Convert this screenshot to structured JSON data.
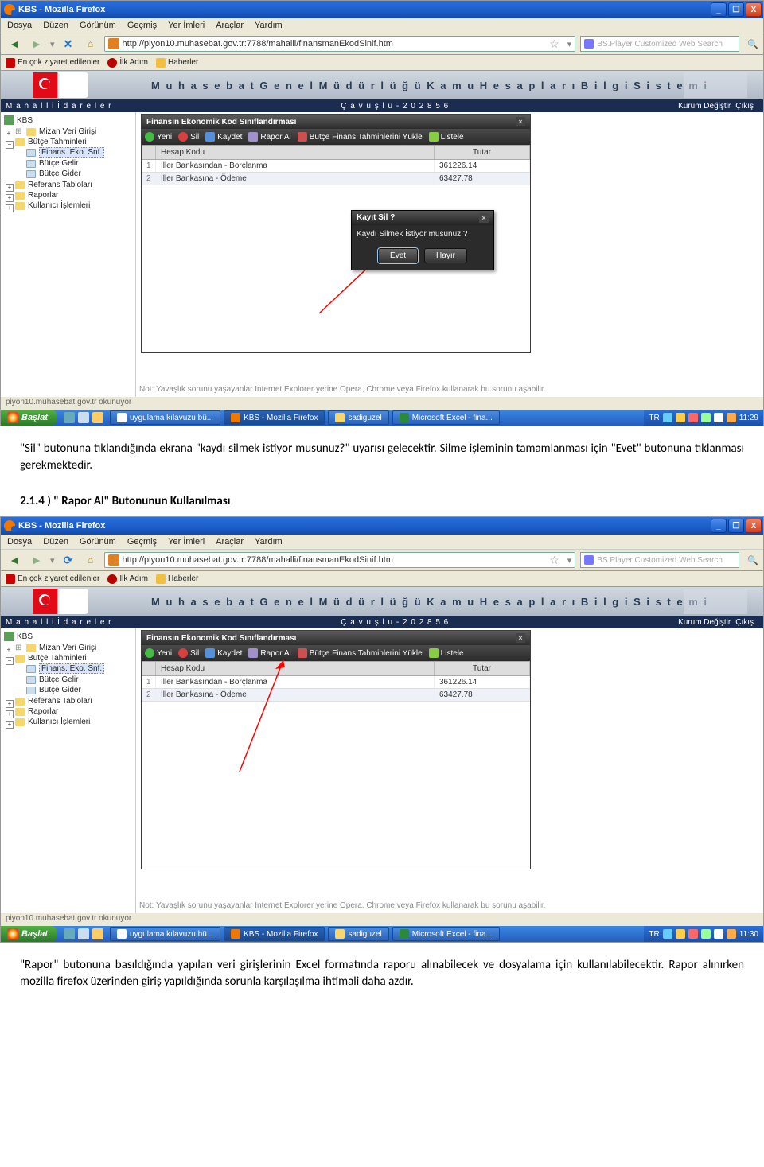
{
  "doc": {
    "para1": "\"Sil\" butonuna tıklandığında ekrana \"kaydı silmek istiyor musunuz?\" uyarısı gelecektir. Silme işleminin tamamlanması için \"Evet\" butonuna tıklanması gerekmektedir.",
    "heading": "2.1.4 ) \" Rapor Al\" Butonunun Kullanılması",
    "para2": "\"Rapor\" butonuna basıldığında yapılan veri girişlerinin Excel formatında raporu alınabilecek ve dosyalama için kullanılabilecektir. Rapor alınırken mozilla firefox üzerinden giriş yapıldığında sorunla karşılaşılma ihtimali daha azdır."
  },
  "firefox": {
    "title": "KBS - Mozilla Firefox",
    "menu": [
      "Dosya",
      "Düzen",
      "Görünüm",
      "Geçmiş",
      "Yer İmleri",
      "Araçlar",
      "Yardım"
    ],
    "url": "http://piyon10.muhasebat.gov.tr:7788/mahalli/finansmanEkodSinif.htm",
    "search_placeholder": "BS.Player Customized Web Search",
    "bookmarks": [
      {
        "label": "En çok ziyaret edilenler"
      },
      {
        "label": "İlk Adım"
      },
      {
        "label": "Haberler"
      }
    ],
    "status": "piyon10.muhasebat.gov.tr okunuyor"
  },
  "app": {
    "banner": "M u h a s e b a t   G e n e l   M ü d ü r l ü ğ ü   K a m u   H e s a p l a r ı   B i l g i   S i s t e m i",
    "subbar": {
      "left": "M a h a l l i   İ d a r e l e r",
      "mid": "Ç a v u ş l u - 2 0 2 8 5 6",
      "right1": "Kurum Değiştir",
      "right2": "Çıkış"
    },
    "tree": {
      "root": "KBS",
      "items": [
        {
          "label": "Mizan Veri Girişi",
          "type": "leaf"
        },
        {
          "label": "Bütçe Tahminleri",
          "type": "exp",
          "children": [
            {
              "label": "Finans. Eko. Snf.",
              "sel": true
            },
            {
              "label": "Bütçe Gelir"
            },
            {
              "label": "Bütçe Gider"
            }
          ]
        },
        {
          "label": "Referans Tabloları",
          "type": "col"
        },
        {
          "label": "Raporlar",
          "type": "col"
        },
        {
          "label": "Kullanıcı İşlemleri",
          "type": "col"
        }
      ]
    },
    "panel": {
      "title": "Finansın Ekonomik Kod Sınıflandırması",
      "toolbar": [
        {
          "key": "yeni",
          "label": "Yeni"
        },
        {
          "key": "sil",
          "label": "Sil"
        },
        {
          "key": "kaydet",
          "label": "Kaydet"
        },
        {
          "key": "rapor",
          "label": "Rapor Al"
        },
        {
          "key": "yukle",
          "label": "Bütçe Finans Tahminlerini Yükle"
        },
        {
          "key": "listele",
          "label": "Listele"
        }
      ],
      "columns": [
        "",
        "Hesap Kodu",
        "Tutar"
      ],
      "rows": [
        {
          "n": "1",
          "kod": "İller Bankasından - Borçlanma",
          "tutar": "361226.14"
        },
        {
          "n": "2",
          "kod": "İller Bankasına - Ödeme",
          "tutar": "63427.78"
        }
      ]
    },
    "note": "Not: Yavaşlık sorunu yaşayanlar Internet Explorer yerine Opera, Chrome veya Firefox kullanarak bu sorunu aşabilir.",
    "dialog": {
      "title": "Kayıt Sil ?",
      "msg": "Kaydı Silmek İstiyor musunuz ?",
      "yes": "Evet",
      "no": "Hayır"
    }
  },
  "taskbar": {
    "start": "Başlat",
    "tasks": [
      {
        "label": "uygulama kılavuzu bü...",
        "ic": "w"
      },
      {
        "label": "KBS - Mozilla Firefox",
        "ic": "ff",
        "active": true
      },
      {
        "label": "sadiguzel",
        "ic": "fld"
      },
      {
        "label": "Microsoft Excel - fina...",
        "ic": "x"
      }
    ],
    "lang": "TR",
    "time1": "11:29",
    "time2": "11:30"
  }
}
